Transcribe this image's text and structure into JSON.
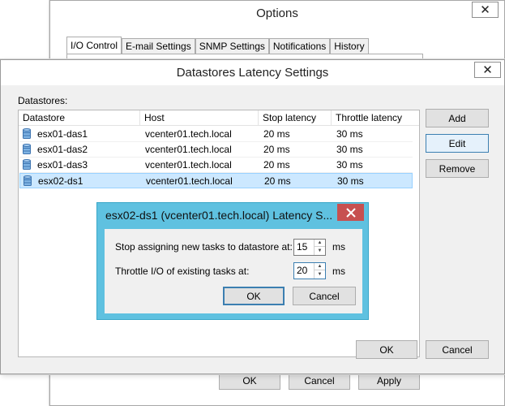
{
  "options_window": {
    "title": "Options",
    "tabs": [
      "I/O Control",
      "E-mail Settings",
      "SNMP Settings",
      "Notifications",
      "History"
    ],
    "buttons": {
      "ok": "OK",
      "cancel": "Cancel",
      "apply": "Apply"
    }
  },
  "latency_window": {
    "title": "Datastores Latency Settings",
    "section_label": "Datastores:",
    "columns": [
      "Datastore",
      "Host",
      "Stop latency",
      "Throttle latency"
    ],
    "rows": [
      {
        "datastore": "esx01-das1",
        "host": "vcenter01.tech.local",
        "stop": "20 ms",
        "throttle": "30 ms"
      },
      {
        "datastore": "esx01-das2",
        "host": "vcenter01.tech.local",
        "stop": "20 ms",
        "throttle": "30 ms"
      },
      {
        "datastore": "esx01-das3",
        "host": "vcenter01.tech.local",
        "stop": "20 ms",
        "throttle": "30 ms"
      },
      {
        "datastore": "esx02-ds1",
        "host": "vcenter01.tech.local",
        "stop": "20 ms",
        "throttle": "30 ms"
      }
    ],
    "selected_row": 3,
    "side_buttons": {
      "add": "Add",
      "edit": "Edit",
      "remove": "Remove"
    },
    "buttons": {
      "ok": "OK",
      "cancel": "Cancel"
    }
  },
  "latency_dialog": {
    "title": "esx02-ds1 (vcenter01.tech.local) Latency S...",
    "stop_label": "Stop assigning new tasks to datastore at:",
    "stop_value": "15",
    "throttle_label": "Throttle I/O of existing tasks at:",
    "throttle_value": "20",
    "unit": "ms",
    "buttons": {
      "ok": "OK",
      "cancel": "Cancel"
    }
  },
  "colors": {
    "accent": "#5fc1e0",
    "close_red": "#c75050",
    "selection": "#cce8ff"
  },
  "icons": {
    "close": "close-icon",
    "datastore": "database-icon",
    "spin_up": "chevron-up-icon",
    "spin_down": "chevron-down-icon"
  }
}
